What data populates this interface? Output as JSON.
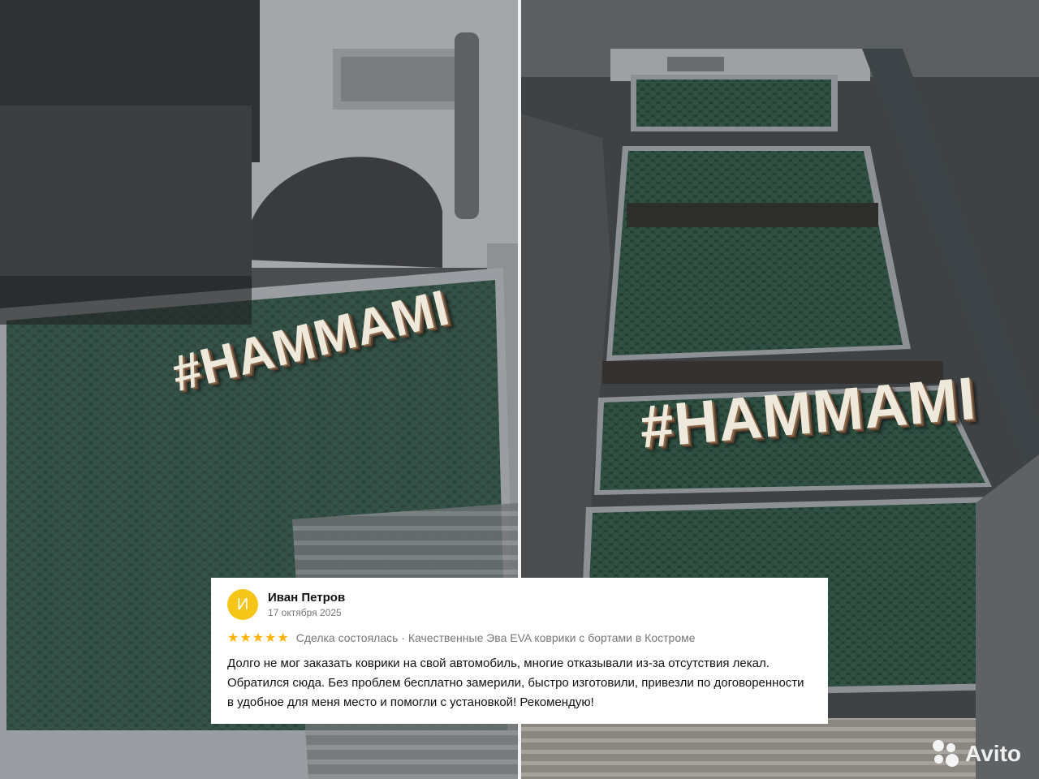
{
  "photos": {
    "left_hashtag": "#HAMMAMI",
    "right_hashtag": "#HAMMAMI"
  },
  "review": {
    "avatar_letter": "И",
    "author": "Иван Петров",
    "date": "17 октября 2025",
    "rating": 5,
    "stars": "★★★★★",
    "meta": "Сделка состоялась · Качественные Эва EVA коврики с бортами в Костроме",
    "text": "Долго не мог заказать коврики на свой автомобиль, многие отказывали из-за отсутствия лекал. Обратился сюда. Без проблем бесплатно замерили, быстро изготовили, привезли по договоренности в удобное для меня место и помогли с установкой! Рекомендую!"
  },
  "watermark": {
    "logo_text": "Avito"
  },
  "colors": {
    "mat_green": "#2f4a3f",
    "mat_border": "#8d9196",
    "avatar_bg": "#f5c518",
    "stars": "#ffb300"
  }
}
